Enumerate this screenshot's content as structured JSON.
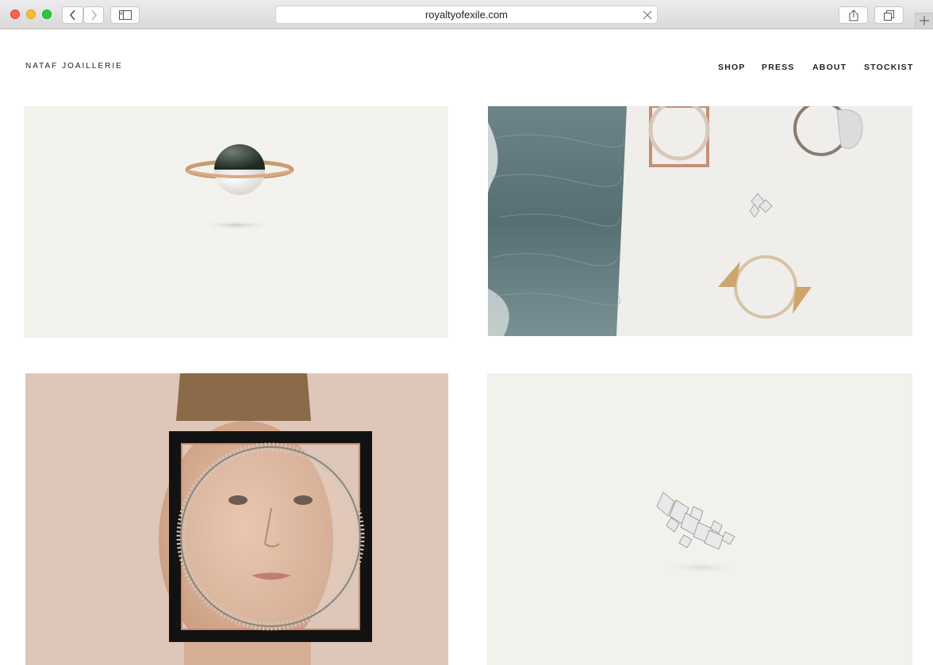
{
  "browser": {
    "url": "royaltyofexile.com",
    "icons": [
      "back-icon",
      "forward-icon",
      "sidebar-icon",
      "share-icon",
      "tabs-icon",
      "clear-icon",
      "new-tab-icon"
    ]
  },
  "site": {
    "logo": "NATAF JOAILLERIE",
    "nav": [
      "SHOP",
      "PRESS",
      "ABOUT",
      "STOCKIST"
    ]
  },
  "colors": {
    "page_bg": "#ffffff",
    "tile_bg": "#f3f2ed",
    "text": "#222222"
  }
}
